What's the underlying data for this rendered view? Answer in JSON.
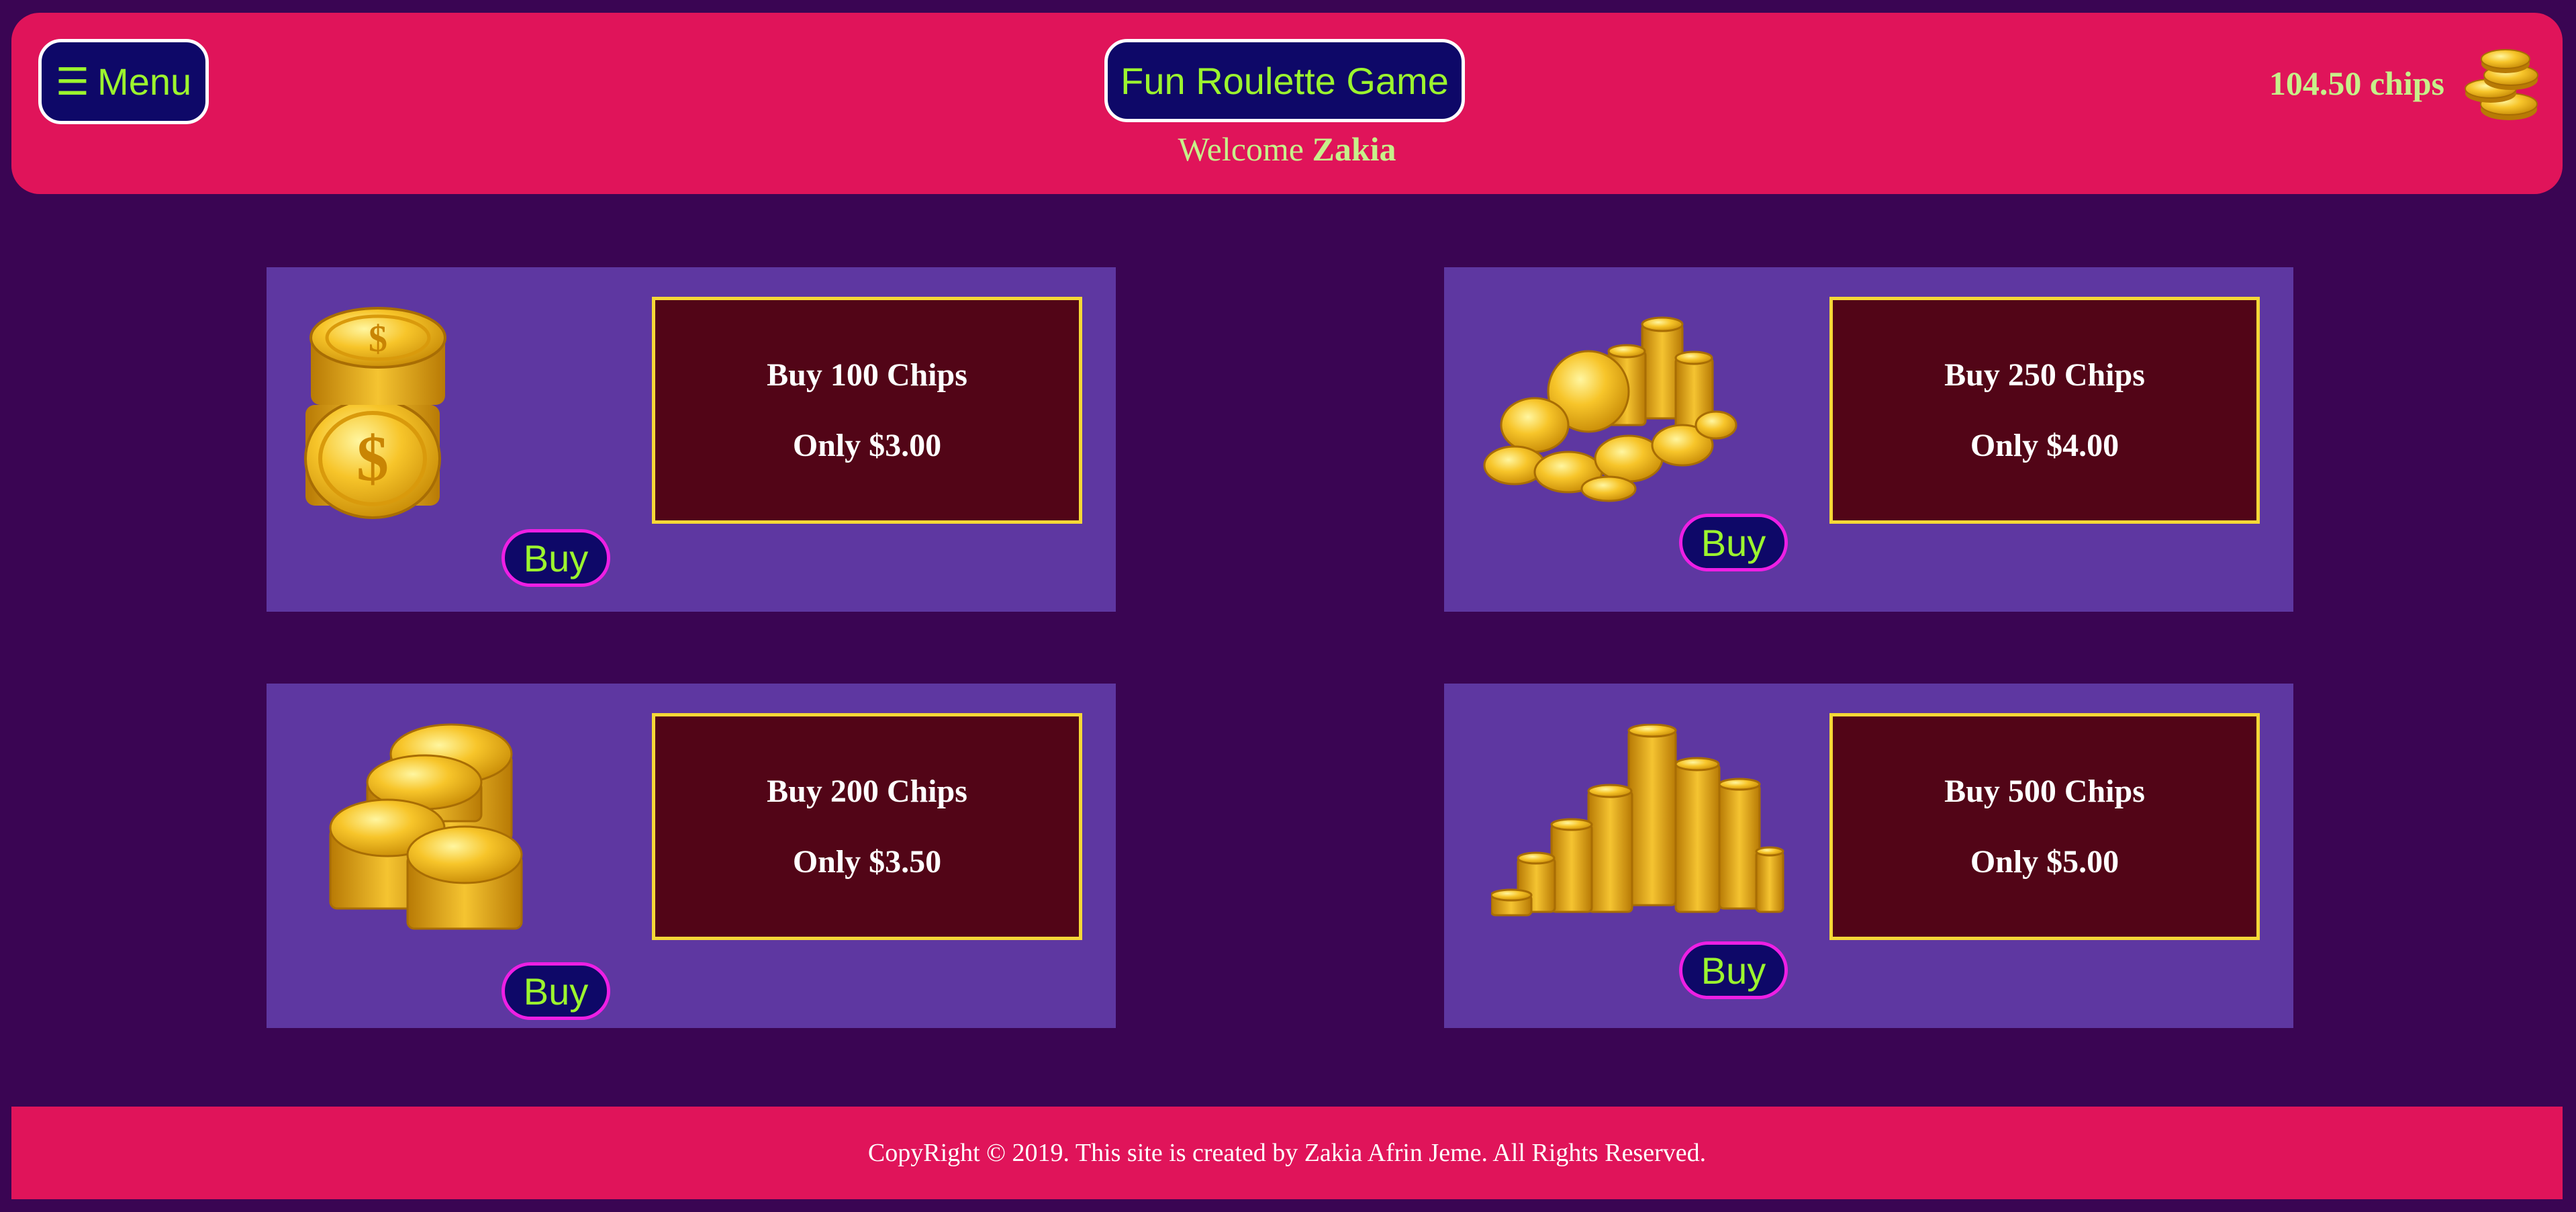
{
  "header": {
    "menu_icon": "☰",
    "menu_label": "Menu",
    "title": "Fun Roulette Game",
    "welcome_prefix": "Welcome",
    "username": "Zakia",
    "chips_balance": "104.50 chips",
    "chips_icon": "coin-stack-icon"
  },
  "offers": [
    {
      "title": "Buy 100 Chips",
      "price": "Only $3.00",
      "button": "Buy",
      "image": "dollar-coin-stack-icon"
    },
    {
      "title": "Buy 250 Chips",
      "price": "Only $4.00",
      "button": "Buy",
      "image": "gold-coin-pile-icon"
    },
    {
      "title": "Buy 200 Chips",
      "price": "Only $3.50",
      "button": "Buy",
      "image": "gold-coin-stacks-icon"
    },
    {
      "title": "Buy 500 Chips",
      "price": "Only $5.00",
      "button": "Buy",
      "image": "tall-coin-stacks-icon"
    }
  ],
  "footer": {
    "text": "CopyRight © 2019. This site is created by Zakia Afrin Jeme. All Rights Reserved."
  },
  "colors": {
    "background": "#3a0553",
    "header_footer": "#e0145a",
    "card": "#5e37a1",
    "offer_box": "#520517",
    "offer_border": "#f5d837",
    "button_bg": "#0e0868",
    "button_text": "#9cf52e",
    "buy_border": "#ee1fe4"
  }
}
